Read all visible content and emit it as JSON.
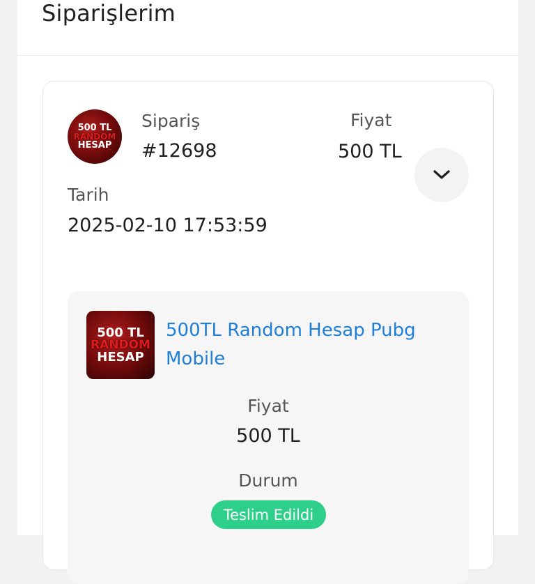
{
  "page": {
    "title": "Siparişlerim"
  },
  "order": {
    "order_label": "Sipariş",
    "order_number": "#12698",
    "price_label": "Fiyat",
    "price_value": "500 TL",
    "date_label": "Tarih",
    "date_value": "2025-02-10 17:53:59",
    "expand_icon": "chevron-down-icon",
    "thumbnail": {
      "line1": "500 TL",
      "line2": "RANDOM",
      "line3": "HESAP"
    }
  },
  "item": {
    "name": "500TL Random Hesap Pubg Mobile",
    "thumbnail": {
      "line1": "500 TL",
      "line2": "RANDOM",
      "line3": "HESAP"
    },
    "price_label": "Fiyat",
    "price_value": "500 TL",
    "status_label": "Durum",
    "status_value": "Teslim Edildi"
  },
  "colors": {
    "link": "#1f7fd8",
    "status_success": "#2ecf8a",
    "thumbnail_bg": "#8b0f0f"
  }
}
